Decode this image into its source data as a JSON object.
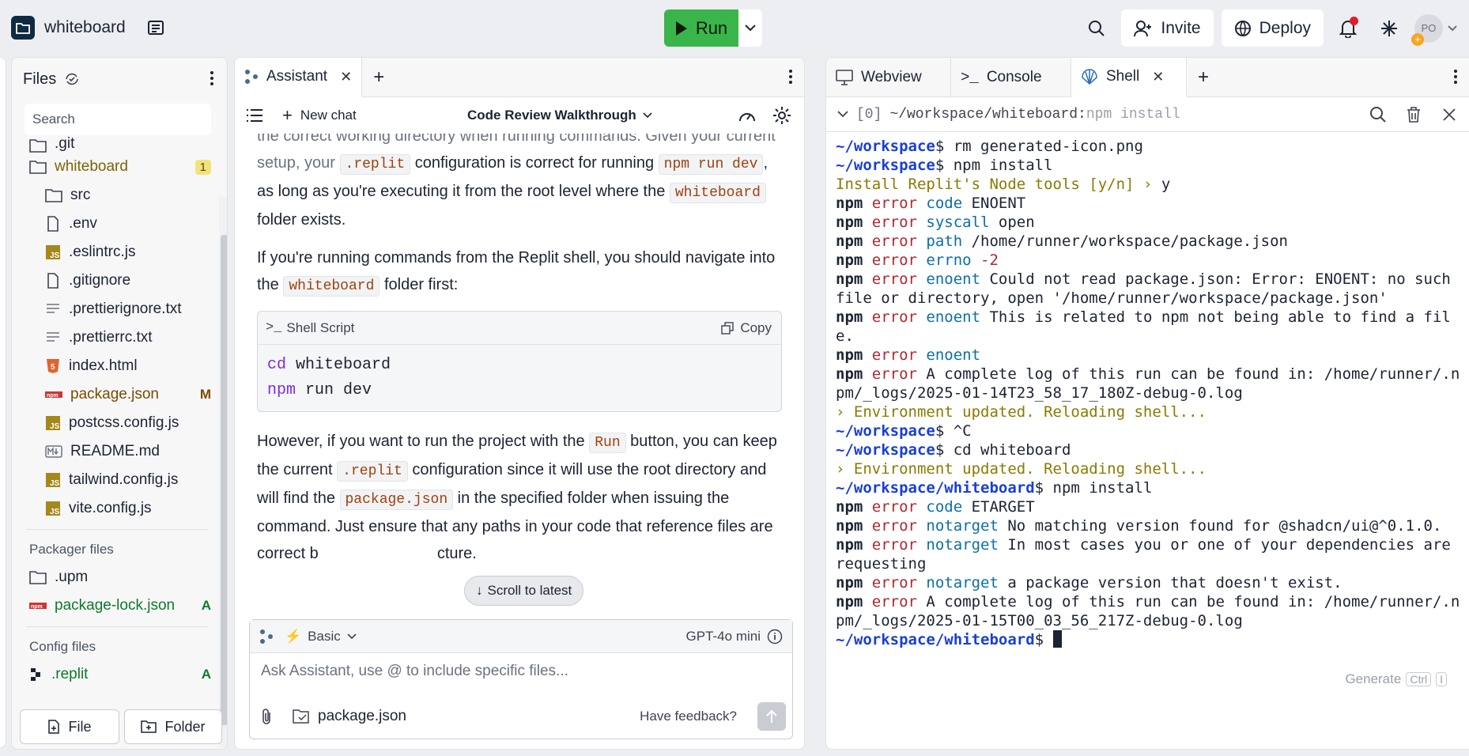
{
  "project": {
    "name": "whiteboard"
  },
  "topbar": {
    "run_label": "Run",
    "invite_label": "Invite",
    "deploy_label": "Deploy",
    "avatar_initials": "PO",
    "avatar_plus": "+"
  },
  "files": {
    "title": "Files",
    "search_placeholder": "Search",
    "items": [
      {
        "name": ".git",
        "type": "folder"
      },
      {
        "name": "whiteboard",
        "type": "folder",
        "badge": "1"
      },
      {
        "name": "src",
        "type": "folder"
      },
      {
        "name": ".env",
        "type": "file"
      },
      {
        "name": ".eslintrc.js",
        "type": "js"
      },
      {
        "name": ".gitignore",
        "type": "file"
      },
      {
        "name": ".prettierignore.txt",
        "type": "text"
      },
      {
        "name": ".prettierrc.txt",
        "type": "text"
      },
      {
        "name": "index.html",
        "type": "html"
      },
      {
        "name": "package.json",
        "type": "npm",
        "status": "M"
      },
      {
        "name": "postcss.config.js",
        "type": "js"
      },
      {
        "name": "README.md",
        "type": "md"
      },
      {
        "name": "tailwind.config.js",
        "type": "js"
      },
      {
        "name": "vite.config.js",
        "type": "js"
      }
    ],
    "packager_title": "Packager files",
    "packager_items": [
      {
        "name": ".upm",
        "type": "folder"
      },
      {
        "name": "package-lock.json",
        "type": "npm",
        "status": "A"
      }
    ],
    "config_title": "Config files",
    "config_items": [
      {
        "name": ".replit",
        "type": "replit",
        "status": "A"
      }
    ],
    "new_file_label": "File",
    "new_folder_label": "Folder"
  },
  "assistant": {
    "tab_label": "Assistant",
    "new_chat_label": "New chat",
    "chat_title": "Code Review Walkthrough",
    "p1_a": "the correct working directory when running commands. Given your current setup, your ",
    "p1_code1": ".replit",
    "p1_b": " configuration is correct for running ",
    "p1_code2": "npm run dev",
    "p1_c": ", as long as you're executing it from the root level where the ",
    "p1_code3": "whiteboard",
    "p1_d": " folder exists.",
    "p2_a": "If you're running commands from the Replit shell, you should navigate into the ",
    "p2_code": "whiteboard",
    "p2_b": " folder first:",
    "code_lang": "Shell Script",
    "copy_label": "Copy",
    "code_line1_kw": "cd",
    "code_line1_rest": " whiteboard",
    "code_line2_kw": "npm",
    "code_line2_rest": " run dev",
    "p3_a": "However, if you want to run the project with the ",
    "p3_code1": "Run",
    "p3_b": " button, you can keep the current ",
    "p3_code2": ".replit",
    "p3_c": " configuration since it will use the root directory and will find the ",
    "p3_code3": "package.json",
    "p3_d": " in the specified folder when issuing the command. Just ensure that any paths in your code that reference files are correct b",
    "p3_e": "cture.",
    "scroll_latest": "Scroll to latest",
    "mode_label": "Basic",
    "model_label": "GPT-4o mini",
    "input_placeholder": "Ask Assistant, use @ to include specific files...",
    "attached_file": "package.json",
    "feedback_label": "Have feedback?"
  },
  "shell": {
    "tabs": [
      "Webview",
      "Console",
      "Shell"
    ],
    "session": "[0]",
    "cwd": "~/workspace/whiteboard:",
    "last_cmd": "npm install",
    "lines": [
      [
        {
          "t": "~/workspace",
          "c": "prompt"
        },
        {
          "t": "$ rm generated-icon.png",
          "c": ""
        }
      ],
      [
        {
          "t": "~/workspace",
          "c": "prompt"
        },
        {
          "t": "$ npm install",
          "c": ""
        }
      ],
      [
        {
          "t": "Install Replit's Node tools [y/n] ",
          "c": "ylw"
        },
        {
          "t": "› ",
          "c": "ylw"
        },
        {
          "t": "y",
          "c": ""
        }
      ],
      [
        {
          "t": "npm",
          "c": "npm"
        },
        {
          "t": " error",
          "c": "err"
        },
        {
          "t": " code",
          "c": "cyan"
        },
        {
          "t": " ENOENT",
          "c": ""
        }
      ],
      [
        {
          "t": "npm",
          "c": "npm"
        },
        {
          "t": " error",
          "c": "err"
        },
        {
          "t": " syscall",
          "c": "cyan"
        },
        {
          "t": " open",
          "c": ""
        }
      ],
      [
        {
          "t": "npm",
          "c": "npm"
        },
        {
          "t": " error",
          "c": "err"
        },
        {
          "t": " path",
          "c": "cyan"
        },
        {
          "t": " /home/runner/workspace/package.json",
          "c": ""
        }
      ],
      [
        {
          "t": "npm",
          "c": "npm"
        },
        {
          "t": " error",
          "c": "err"
        },
        {
          "t": " errno",
          "c": "cyan"
        },
        {
          "t": " -2",
          "c": "err"
        }
      ],
      [
        {
          "t": "npm",
          "c": "npm"
        },
        {
          "t": " error",
          "c": "err"
        },
        {
          "t": " enoent",
          "c": "cyan"
        },
        {
          "t": " Could not read package.json: Error: ENOENT: no such file or directory, open '/home/runner/workspace/package.json'",
          "c": ""
        }
      ],
      [
        {
          "t": "npm",
          "c": "npm"
        },
        {
          "t": " error",
          "c": "err"
        },
        {
          "t": " enoent",
          "c": "cyan"
        },
        {
          "t": " This is related to npm not being able to find a file.",
          "c": ""
        }
      ],
      [
        {
          "t": "npm",
          "c": "npm"
        },
        {
          "t": " error",
          "c": "err"
        },
        {
          "t": " enoent",
          "c": "cyan"
        }
      ],
      [
        {
          "t": "npm",
          "c": "npm"
        },
        {
          "t": " error",
          "c": "err"
        },
        {
          "t": " A complete log of this run can be found in: /home/runner/.npm/_logs/2025-01-14T23_58_17_180Z-debug-0.log",
          "c": ""
        }
      ],
      [
        {
          "t": "› Environment updated. Reloading shell...",
          "c": "ylw"
        }
      ],
      [
        {
          "t": "~/workspace",
          "c": "prompt"
        },
        {
          "t": "$ ^C",
          "c": ""
        }
      ],
      [
        {
          "t": "~/workspace",
          "c": "prompt"
        },
        {
          "t": "$ cd whiteboard",
          "c": ""
        }
      ],
      [
        {
          "t": "› Environment updated. Reloading shell...",
          "c": "ylw"
        }
      ],
      [
        {
          "t": "~/workspace/whiteboard",
          "c": "prompt"
        },
        {
          "t": "$ npm install",
          "c": ""
        }
      ],
      [
        {
          "t": "npm",
          "c": "npm"
        },
        {
          "t": " error",
          "c": "err"
        },
        {
          "t": " code",
          "c": "cyan"
        },
        {
          "t": " ETARGET",
          "c": ""
        }
      ],
      [
        {
          "t": "npm",
          "c": "npm"
        },
        {
          "t": " error",
          "c": "err"
        },
        {
          "t": " notarget",
          "c": "cyan"
        },
        {
          "t": " No matching version found for @shadcn/ui@^0.1.0.",
          "c": ""
        }
      ],
      [
        {
          "t": "npm",
          "c": "npm"
        },
        {
          "t": " error",
          "c": "err"
        },
        {
          "t": " notarget",
          "c": "cyan"
        },
        {
          "t": " In most cases you or one of your dependencies are requesting",
          "c": ""
        }
      ],
      [
        {
          "t": "npm",
          "c": "npm"
        },
        {
          "t": " error",
          "c": "err"
        },
        {
          "t": " notarget",
          "c": "cyan"
        },
        {
          "t": " a package version that doesn't exist.",
          "c": ""
        }
      ],
      [
        {
          "t": "npm",
          "c": "npm"
        },
        {
          "t": " error",
          "c": "err"
        },
        {
          "t": " A complete log of this run can be found in: /home/runner/.npm/_logs/2025-01-15T00_03_56_217Z-debug-0.log",
          "c": ""
        }
      ],
      [
        {
          "t": "~/workspace/whiteboard",
          "c": "prompt"
        },
        {
          "t": "$ ",
          "c": ""
        }
      ]
    ],
    "generate_label": "Generate",
    "generate_key1": "Ctrl",
    "generate_key2": "I"
  }
}
